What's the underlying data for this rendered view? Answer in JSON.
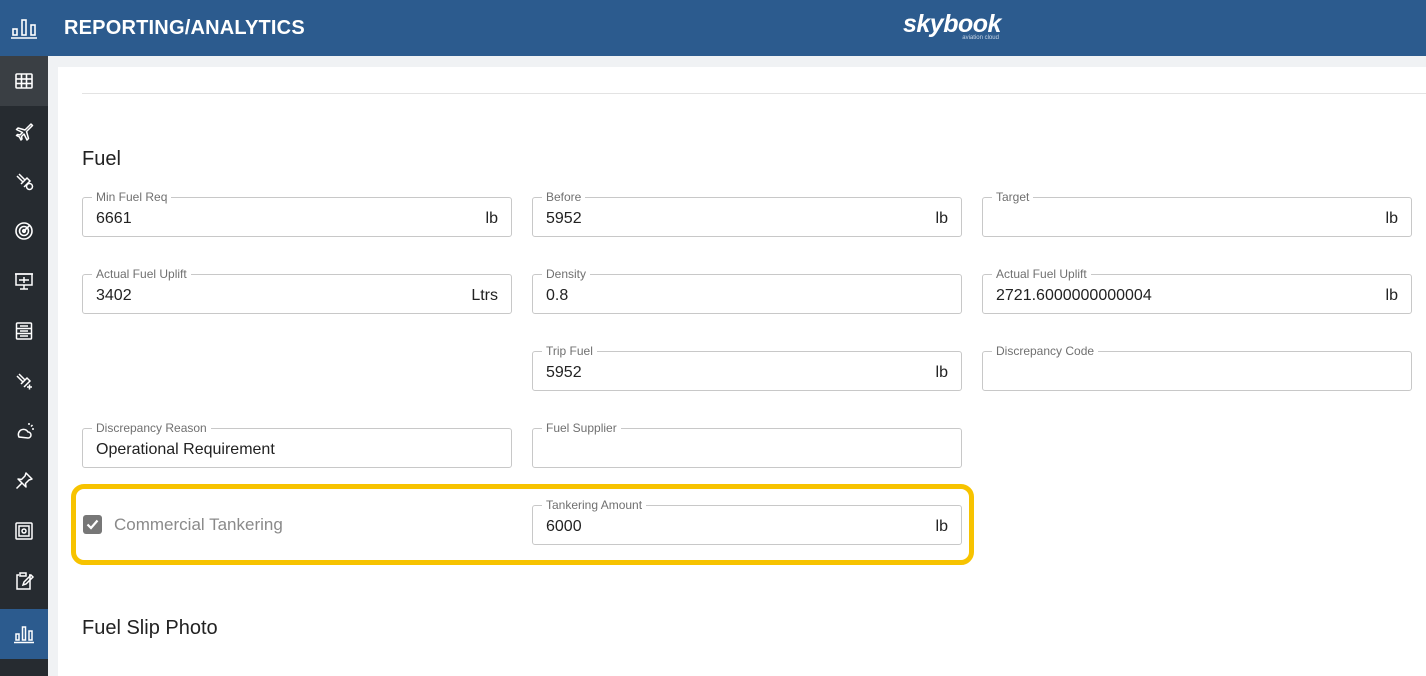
{
  "header": {
    "title": "REPORTING/ANALYTICS",
    "logo_brand": "skybook",
    "logo_tagline": "aviation cloud",
    "app_icon": "bar-chart-icon"
  },
  "sidebar": {
    "items": [
      {
        "icon": "table-grid-icon"
      },
      {
        "icon": "airplane-icon"
      },
      {
        "icon": "airplane-takeoff-icon"
      },
      {
        "icon": "radar-icon"
      },
      {
        "icon": "briefing-board-icon"
      },
      {
        "icon": "list-form-icon"
      },
      {
        "icon": "airplane-landing-icon"
      },
      {
        "icon": "weather-icon"
      },
      {
        "icon": "pin-icon"
      },
      {
        "icon": "safe-icon"
      },
      {
        "icon": "clipboard-edit-icon"
      },
      {
        "icon": "bar-chart-icon"
      }
    ]
  },
  "fuel": {
    "section_title": "Fuel",
    "min_fuel_req": {
      "label": "Min Fuel Req",
      "value": "6661",
      "unit": "lb"
    },
    "before": {
      "label": "Before",
      "value": "5952",
      "unit": "lb"
    },
    "target": {
      "label": "Target",
      "value": "",
      "unit": "lb"
    },
    "actual_fuel_uplift_ltrs": {
      "label": "Actual Fuel Uplift",
      "value": "3402",
      "unit": "Ltrs"
    },
    "density": {
      "label": "Density",
      "value": "0.8"
    },
    "actual_fuel_uplift_lb": {
      "label": "Actual Fuel Uplift",
      "value": "2721.6000000000004",
      "unit": "lb"
    },
    "trip_fuel": {
      "label": "Trip Fuel",
      "value": "5952",
      "unit": "lb"
    },
    "discrepancy_code": {
      "label": "Discrepancy Code",
      "value": ""
    },
    "discrepancy_reason": {
      "label": "Discrepancy Reason",
      "value": "Operational Requirement"
    },
    "fuel_supplier": {
      "label": "Fuel Supplier",
      "value": ""
    },
    "commercial_tankering": {
      "label": "Commercial Tankering",
      "checked": true
    },
    "tankering_amount": {
      "label": "Tankering Amount",
      "value": "6000",
      "unit": "lb"
    }
  },
  "fuel_slip": {
    "section_title": "Fuel Slip Photo"
  },
  "colors": {
    "header": "#2c5b8e",
    "sidebar": "#262b30",
    "highlight": "#f7c300"
  }
}
